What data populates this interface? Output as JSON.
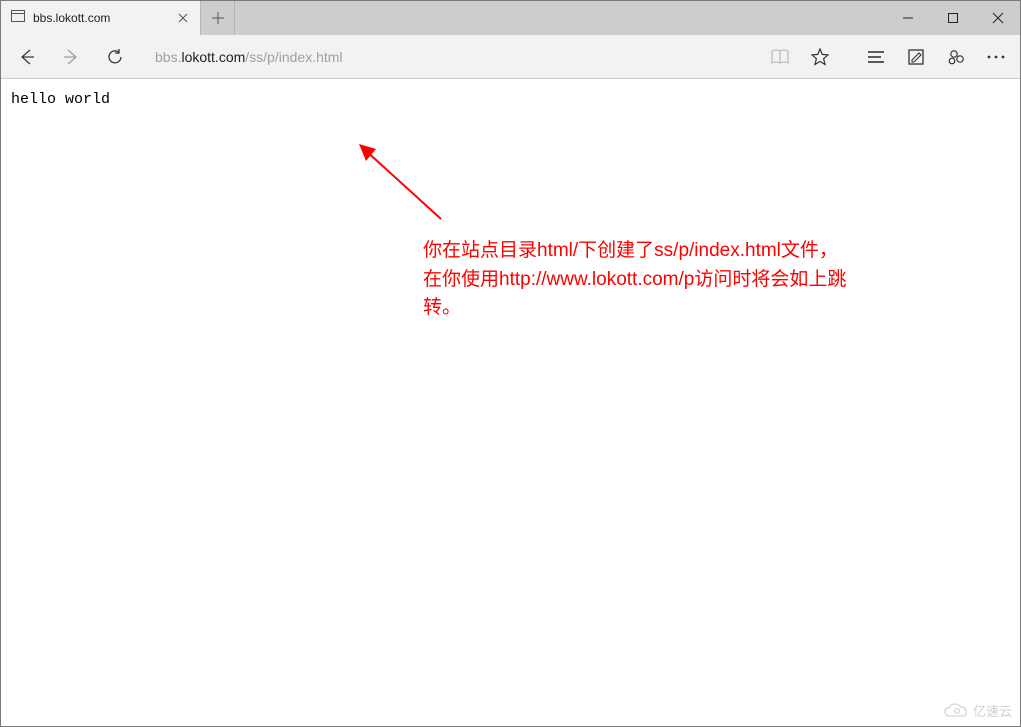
{
  "tab": {
    "title": "bbs.lokott.com"
  },
  "url": {
    "pre": "bbs.",
    "host": "lokott.com",
    "path": "/ss/p/index.html"
  },
  "page": {
    "body_text": "hello world"
  },
  "annotation": {
    "text": "你在站点目录html/下创建了ss/p/index.html文件，在你使用http://www.lokott.com/p访问时将会如上跳转。"
  },
  "watermark": {
    "text": "亿速云"
  }
}
